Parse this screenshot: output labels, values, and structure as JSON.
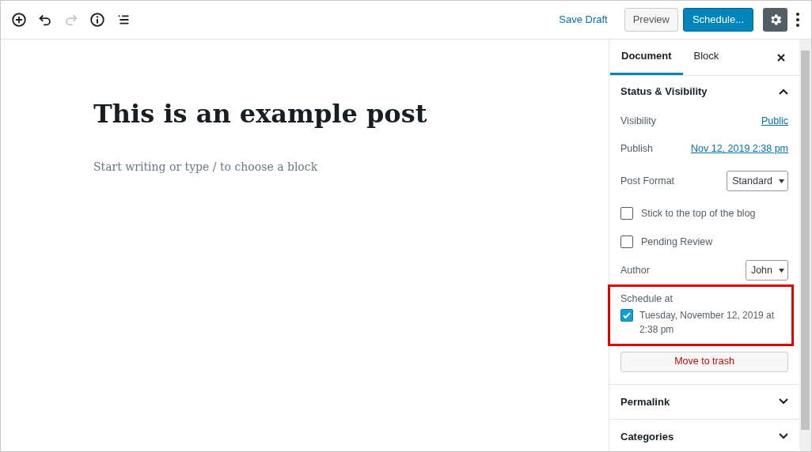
{
  "toolbar": {
    "tools": [
      {
        "kind": "add",
        "disabled": false
      },
      {
        "kind": "undo",
        "disabled": false
      },
      {
        "kind": "redo",
        "disabled": true
      },
      {
        "kind": "info",
        "disabled": false
      },
      {
        "kind": "outline",
        "disabled": false
      }
    ],
    "save_draft": "Save Draft",
    "preview": "Preview",
    "schedule": "Schedule...",
    "settings_active": true
  },
  "editor": {
    "title": "This is an example post",
    "placeholder": "Start writing or type / to choose a block"
  },
  "sidebar": {
    "tabs": [
      {
        "label": "Document",
        "selected": true
      },
      {
        "label": "Block",
        "selected": false
      }
    ],
    "panels": [
      {
        "title": "Status & Visibility",
        "expanded": true,
        "rows": [
          {
            "kind": "link",
            "label": "Visibility",
            "value": "Public"
          },
          {
            "kind": "link",
            "label": "Publish",
            "value": "Nov 12, 2019 2:38 pm"
          },
          {
            "kind": "select",
            "label": "Post Format",
            "value": "Standard"
          },
          {
            "kind": "checkbox",
            "label": "Stick to the top of the blog",
            "checked": false
          },
          {
            "kind": "checkbox",
            "label": "Pending Review",
            "checked": false
          },
          {
            "kind": "select",
            "label": "Author",
            "value": "John"
          }
        ],
        "schedule": {
          "label": "Schedule at",
          "text": "Tuesday, November 12, 2019 at 2:38 pm",
          "checked": true,
          "highlighted": true
        },
        "trash": "Move to trash"
      },
      {
        "title": "Permalink",
        "expanded": false
      },
      {
        "title": "Categories",
        "expanded": false
      }
    ]
  }
}
